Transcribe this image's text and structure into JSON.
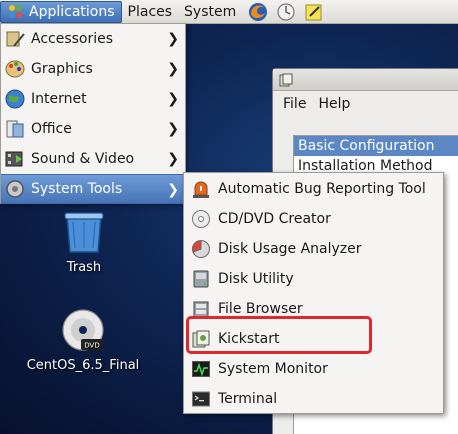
{
  "panel": {
    "menus": [
      "Applications",
      "Places",
      "System"
    ],
    "launchers": [
      "firefox-icon",
      "mail-icon",
      "notes-icon"
    ]
  },
  "applications_menu": {
    "items": [
      {
        "label": "Accessories",
        "icon": "accessories-icon"
      },
      {
        "label": "Graphics",
        "icon": "graphics-icon"
      },
      {
        "label": "Internet",
        "icon": "internet-icon"
      },
      {
        "label": "Office",
        "icon": "office-icon"
      },
      {
        "label": "Sound & Video",
        "icon": "sound-video-icon"
      },
      {
        "label": "System Tools",
        "icon": "system-tools-icon",
        "highlighted": true
      }
    ]
  },
  "system_tools_submenu": {
    "items": [
      {
        "label": "Automatic Bug Reporting Tool",
        "icon": "bug-report-icon"
      },
      {
        "label": "CD/DVD Creator",
        "icon": "cd-icon"
      },
      {
        "label": "Disk Usage Analyzer",
        "icon": "disk-usage-icon"
      },
      {
        "label": "Disk Utility",
        "icon": "disk-utility-icon"
      },
      {
        "label": "File Browser",
        "icon": "file-browser-icon"
      },
      {
        "label": "Kickstart",
        "icon": "kickstart-icon",
        "outlined": true
      },
      {
        "label": "System Monitor",
        "icon": "system-monitor-icon"
      },
      {
        "label": "Terminal",
        "icon": "terminal-icon"
      }
    ]
  },
  "desktop": {
    "icons": [
      {
        "label": "Trash",
        "icon": "trash-icon"
      },
      {
        "label": "CentOS_6.5_Final",
        "icon": "dvd-icon"
      }
    ]
  },
  "window": {
    "menubar": [
      "File",
      "Help"
    ],
    "rows": [
      "Basic Configuration",
      "Installation Method"
    ]
  },
  "colors": {
    "highlight": "#4674b7",
    "annotation": "#e0282c"
  }
}
